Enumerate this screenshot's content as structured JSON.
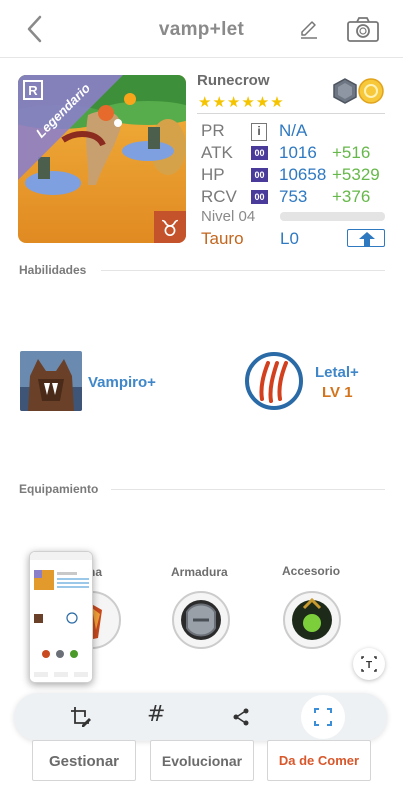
{
  "header": {
    "title": "vamp+let"
  },
  "monster": {
    "name": "Runecrow",
    "stars": "★★★★★★",
    "rarity_label": "Legendario",
    "stats": {
      "pr": {
        "label": "PR",
        "value": "N/A"
      },
      "atk": {
        "label": "ATK",
        "value": "1016",
        "bonus": "+516"
      },
      "hp": {
        "label": "HP",
        "value": "10658",
        "bonus": "+5329"
      },
      "rcv": {
        "label": "RCV",
        "value": "753",
        "bonus": "+376"
      }
    },
    "badge_text": "00",
    "info_icon_text": "i",
    "level_label": "Nivel 04",
    "level_progress": 0,
    "zodiac": "Tauro",
    "limit": "L0"
  },
  "sections": {
    "abilities": "Habilidades",
    "equipment": "Equipamiento"
  },
  "abilities": [
    {
      "name": "Vampiro+"
    },
    {
      "name": "Letal+",
      "level": "LV 1"
    }
  ],
  "equipment": [
    {
      "label": "Arma",
      "visible_label": "na"
    },
    {
      "label": "Armadura"
    },
    {
      "label": "Accesorio"
    }
  ],
  "toolbar": {
    "hash": "#"
  },
  "buttons": {
    "manage": "Gestionar",
    "evolve": "Evolucionar",
    "feed": "Da de Comer"
  },
  "colors": {
    "accent_blue": "#2f79c1",
    "bonus_green": "#66b84a",
    "zodiac_orange": "#c2661e",
    "star_yellow": "#f5c400",
    "legendary_purple": "#8c7fc9",
    "feed_red": "#d9572b"
  }
}
